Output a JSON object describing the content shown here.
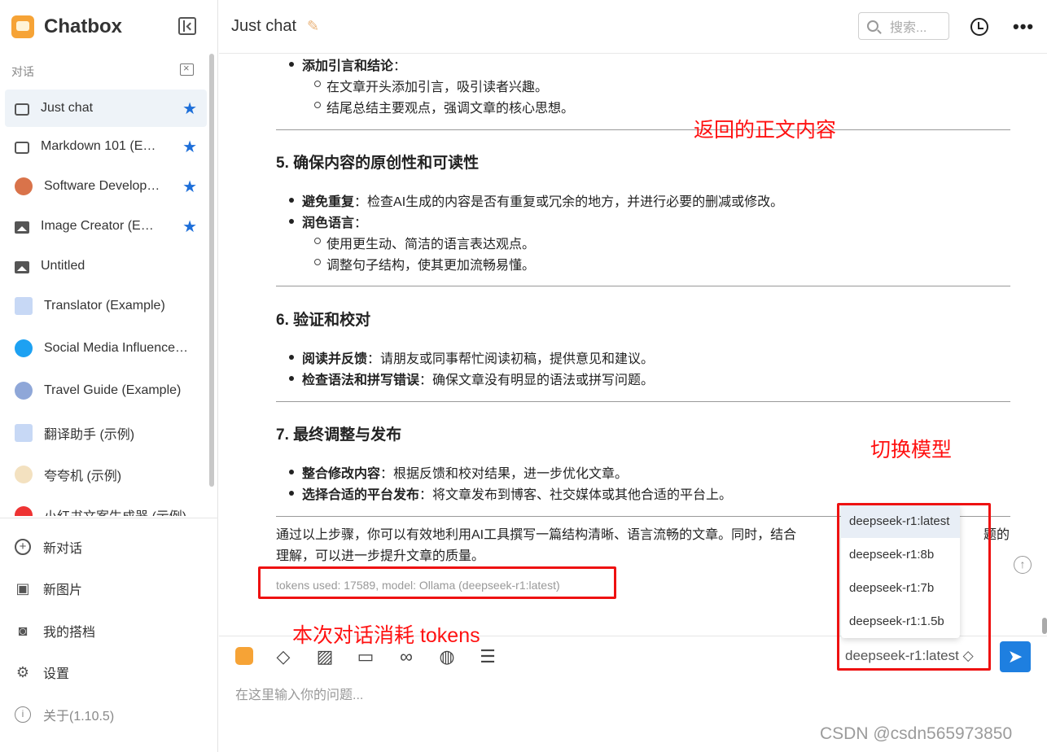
{
  "app": {
    "name": "Chatbox"
  },
  "sidebar": {
    "section_label": "对话",
    "conversations": [
      {
        "label": "Just chat",
        "icon": "chat-icon",
        "starred": true,
        "active": true
      },
      {
        "label": "Markdown 101 (E…",
        "icon": "chat-icon",
        "starred": true
      },
      {
        "label": "Software Develop…",
        "icon": "developer-avatar-icon",
        "starred": true
      },
      {
        "label": "Image Creator (E…",
        "icon": "image-icon",
        "starred": true
      },
      {
        "label": "Untitled",
        "icon": "image-icon",
        "starred": false
      },
      {
        "label": "Translator (Example)",
        "icon": "translate-icon",
        "starred": false
      },
      {
        "label": "Social Media Influence…",
        "icon": "twitter-icon",
        "starred": false
      },
      {
        "label": "Travel Guide (Example)",
        "icon": "globe-avatar-icon",
        "starred": false
      },
      {
        "label": "翻译助手 (示例)",
        "icon": "translate-icon",
        "starred": false
      },
      {
        "label": "夸夸机 (示例)",
        "icon": "cheer-avatar-icon",
        "starred": false
      },
      {
        "label": "小红书文案生成器 (示例)",
        "icon": "red-avatar-icon",
        "starred": false
      }
    ],
    "actions": {
      "new_chat": "新对话",
      "new_image": "新图片",
      "my_partners": "我的搭档",
      "settings": "设置",
      "about": "关于(1.10.5)"
    }
  },
  "header": {
    "title": "Just chat",
    "search_placeholder": "搜索..."
  },
  "message": {
    "section4_item": "添加引言和结论",
    "section4_subs": [
      "在文章开头添加引言，吸引读者兴趣。",
      "结尾总结主要观点，强调文章的核心思想。"
    ],
    "section5_heading": "5. 确保内容的原创性和可读性",
    "section5_b1_bold": "避免重复",
    "section5_b1_text": "：检查AI生成的内容是否有重复或冗余的地方，并进行必要的删减或修改。",
    "section5_b2_bold": "润色语言",
    "section5_b2_subs": [
      "使用更生动、简洁的语言表达观点。",
      "调整句子结构，使其更加流畅易懂。"
    ],
    "section6_heading": "6. 验证和校对",
    "section6_b1_bold": "阅读并反馈",
    "section6_b1_text": "：请朋友或同事帮忙阅读初稿，提供意见和建议。",
    "section6_b2_bold": "检查语法和拼写错误",
    "section6_b2_text": "：确保文章没有明显的语法或拼写问题。",
    "section7_heading": "7. 最终调整与发布",
    "section7_b1_bold": "整合修改内容",
    "section7_b1_text": "：根据反馈和校对结果，进一步优化文章。",
    "section7_b2_bold": "选择合适的平台发布",
    "section7_b2_text": "：将文章发布到博客、社交媒体或其他合适的平台上。",
    "conclusion_line1": "通过以上步骤，你可以有效地利用AI工具撰写一篇结构清晰、语言流畅的文章。同时，结合",
    "conclusion_line1_tail": "题的",
    "conclusion_line2": "理解，可以进一步提升文章的质量。",
    "tokens": "tokens used: 17589, model: Ollama (deepseek-r1:latest)"
  },
  "annotations": {
    "body": "返回的正文内容",
    "switch_model": "切换模型",
    "tokens": "本次对话消耗 tokens"
  },
  "input": {
    "placeholder": "在这里输入你的问题...",
    "model": "deepseek-r1:latest ◇"
  },
  "model_dropdown": {
    "options": [
      "deepseek-r1:latest",
      "deepseek-r1:8b",
      "deepseek-r1:7b",
      "deepseek-r1:1.5b"
    ],
    "selected": "deepseek-r1:latest"
  },
  "watermark": "CSDN @csdn565973850",
  "colors": {
    "accent": "#1e7fe0",
    "star": "#1e6fd9",
    "annotation": "#ff1111",
    "brand": "#f6a336"
  }
}
